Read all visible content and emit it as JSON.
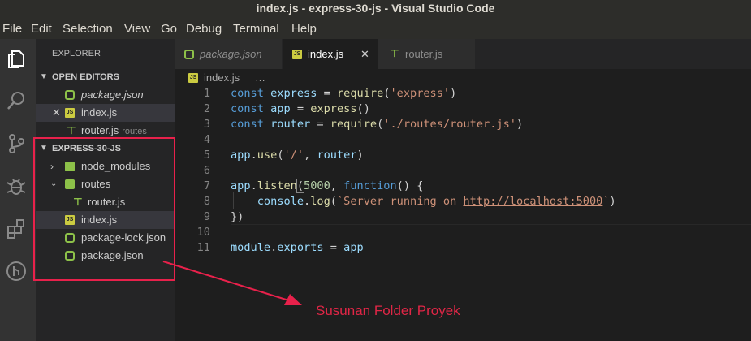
{
  "window": {
    "title": "index.js - express-30-js - Visual Studio Code"
  },
  "menu": [
    "File",
    "Edit",
    "Selection",
    "View",
    "Go",
    "Debug",
    "Terminal",
    "Help"
  ],
  "activity": [
    "files-icon",
    "search-icon",
    "source-control-icon",
    "debug-icon",
    "extensions-icon",
    "git-graph-icon"
  ],
  "sidebar": {
    "title": "EXPLORER",
    "open_editors_label": "OPEN EDITORS",
    "open_editors": [
      {
        "name": "package.json",
        "desc": ""
      },
      {
        "name": "index.js",
        "desc": ""
      },
      {
        "name": "router.js",
        "desc": "routes"
      }
    ],
    "project_label": "EXPRESS-30-JS",
    "tree": [
      "node_modules",
      "routes",
      "router.js",
      "index.js",
      "package-lock.json",
      "package.json"
    ]
  },
  "tabs": [
    {
      "label": "package.json",
      "close": ""
    },
    {
      "label": "index.js",
      "close": "✕"
    },
    {
      "label": "router.js",
      "close": ""
    }
  ],
  "breadcrumb": {
    "file": "index.js",
    "more": "…"
  },
  "editor": {
    "line_numbers": [
      "1",
      "2",
      "3",
      "4",
      "5",
      "6",
      "7",
      "8",
      "9",
      "10",
      "11"
    ],
    "code": {
      "l1": {
        "kw": "const",
        "var": "express",
        "op": " = ",
        "fn": "require",
        "p1": "(",
        "str": "'express'",
        "p2": ")"
      },
      "l2": {
        "kw": "const",
        "var": "app",
        "op": " = ",
        "fn": "express",
        "p": "()"
      },
      "l3": {
        "kw": "const",
        "var": "router",
        "op": " = ",
        "fn": "require",
        "p1": "(",
        "str": "'./routes/router.js'",
        "p2": ")"
      },
      "l5": {
        "obj": "app",
        "dot": ".",
        "fn": "use",
        "p1": "(",
        "str": "'/'",
        "sep": ", ",
        "var": "router",
        "p2": ")"
      },
      "l7": {
        "obj": "app",
        "dot": ".",
        "fn": "listen",
        "p1": "(",
        "num": "5000",
        "sep": ", ",
        "kw": "function",
        "rest": "() {"
      },
      "l8": {
        "indent": "    ",
        "obj": "console",
        "dot": ".",
        "fn": "log",
        "p1": "(",
        "str1": "`Server running on ",
        "url": "http://localhost:5000",
        "str2": "`",
        "p2": ")"
      },
      "l9": {
        "text": "})"
      },
      "l11": {
        "obj": "module",
        "dot": ".",
        "prop": "exports",
        "op": " = ",
        "var": "app"
      }
    }
  },
  "annotation": {
    "text": "Susunan Folder Proyek",
    "color": "#e02646"
  }
}
